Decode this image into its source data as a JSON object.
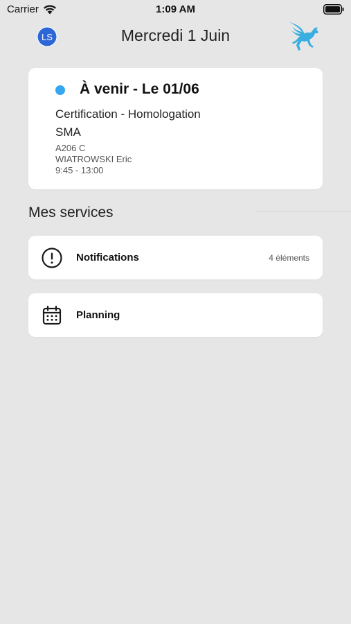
{
  "status_bar": {
    "carrier": "Carrier",
    "time": "1:09 AM",
    "wifi_icon": "wifi-icon",
    "battery_icon": "battery-icon"
  },
  "header": {
    "avatar_initials": "LS",
    "title": "Mercredi 1 Juin",
    "logo_icon": "pegasus-logo-icon"
  },
  "event": {
    "status_color": "#35a7f0",
    "heading": "À venir - Le 01/06",
    "course": "Certification - Homologation",
    "group": "SMA",
    "room": "A206 C",
    "teacher": "WIATROWSKI Eric",
    "hours": "9:45 - 13:00"
  },
  "services": {
    "title": "Mes services",
    "items": [
      {
        "icon": "alert-circle-icon",
        "label": "Notifications",
        "count": "4 éléments"
      },
      {
        "icon": "calendar-icon",
        "label": "Planning",
        "count": ""
      }
    ]
  },
  "colors": {
    "background": "#e6e6e6",
    "card": "#ffffff",
    "accent_dot": "#35a7f0",
    "avatar": "#2d67d6",
    "logo": "#3aaee0"
  }
}
